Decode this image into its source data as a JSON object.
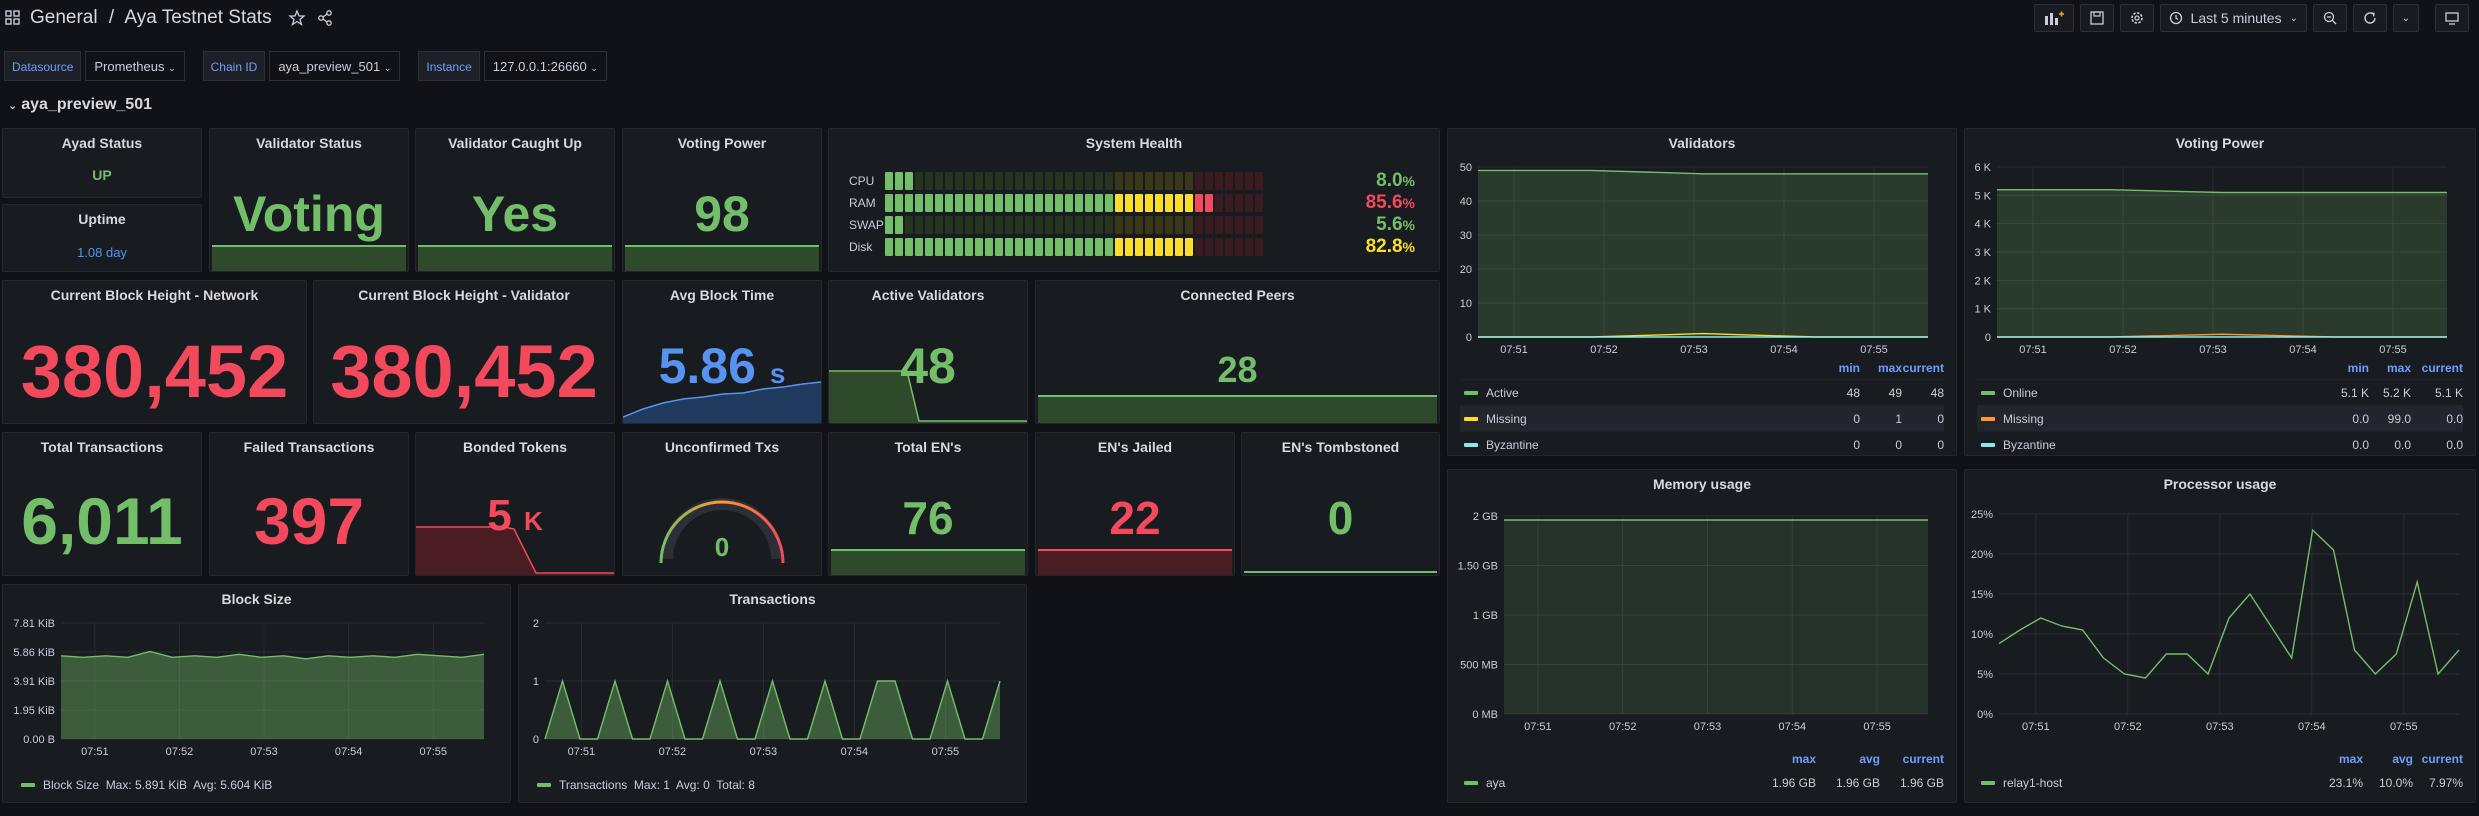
{
  "header": {
    "folder": "General",
    "separator": "/",
    "title": "Aya Testnet Stats",
    "time_range": "Last 5 minutes"
  },
  "variables": [
    {
      "label": "Datasource",
      "value": "Prometheus"
    },
    {
      "label": "Chain ID",
      "value": "aya_preview_501"
    },
    {
      "label": "Instance",
      "value": "127.0.0.1:26660"
    }
  ],
  "row_title": "aya_preview_501",
  "colors": {
    "green": "#73bf69",
    "red": "#f2495c",
    "blue": "#5794f2",
    "yellow": "#fade2a",
    "orange": "#ff9830",
    "cyan": "#8ae8e8"
  },
  "stats": {
    "ayad_status": {
      "title": "Ayad Status",
      "value": "UP"
    },
    "uptime": {
      "title": "Uptime",
      "value": "1.08 day"
    },
    "validator_status": {
      "title": "Validator Status",
      "value": "Voting"
    },
    "caught_up": {
      "title": "Validator Caught Up",
      "value": "Yes"
    },
    "voting_power": {
      "title": "Voting Power",
      "value": "98"
    },
    "block_height_network": {
      "title": "Current Block Height - Network",
      "value": "380,452"
    },
    "block_height_validator": {
      "title": "Current Block Height - Validator",
      "value": "380,452"
    },
    "avg_block_time": {
      "title": "Avg Block Time",
      "value": "5.86",
      "unit": "s"
    },
    "active_validators": {
      "title": "Active Validators",
      "value": "48"
    },
    "connected_peers": {
      "title": "Connected Peers",
      "value": "28"
    },
    "total_transactions": {
      "title": "Total Transactions",
      "value": "6,011"
    },
    "failed_transactions": {
      "title": "Failed Transactions",
      "value": "397"
    },
    "bonded_tokens": {
      "title": "Bonded Tokens",
      "value": "5",
      "unit": "K"
    },
    "unconfirmed_txs": {
      "title": "Unconfirmed Txs",
      "value": "0"
    },
    "total_ens": {
      "title": "Total EN's",
      "value": "76"
    },
    "ens_jailed": {
      "title": "EN's Jailed",
      "value": "22"
    },
    "ens_tombstoned": {
      "title": "EN's Tombstoned",
      "value": "0"
    }
  },
  "system_health": {
    "title": "System Health",
    "rows": [
      {
        "label": "CPU",
        "value": "8.0",
        "unit": "%",
        "level": 0.08
      },
      {
        "label": "RAM",
        "value": "85.6",
        "unit": "%",
        "level": 0.856
      },
      {
        "label": "SWAP",
        "value": "5.6",
        "unit": "%",
        "level": 0.056
      },
      {
        "label": "Disk",
        "value": "82.8",
        "unit": "%",
        "level": 0.828
      }
    ]
  },
  "validators_chart": {
    "title": "Validators",
    "chart_data": {
      "type": "line",
      "x": [
        "07:51",
        "07:52",
        "07:53",
        "07:54",
        "07:55"
      ],
      "ylim": [
        0,
        50
      ],
      "yticks": [
        "0",
        "10",
        "20",
        "30",
        "40",
        "50"
      ],
      "series": [
        {
          "name": "Active",
          "values": [
            49,
            49,
            48,
            48,
            48
          ],
          "min": "48",
          "max": "49",
          "current": "48"
        },
        {
          "name": "Missing",
          "values": [
            0,
            0,
            1,
            0,
            0
          ],
          "min": "0",
          "max": "1",
          "current": "0"
        },
        {
          "name": "Byzantine",
          "values": [
            0,
            0,
            0,
            0,
            0
          ],
          "min": "0",
          "max": "0",
          "current": "0"
        }
      ]
    },
    "legend_headers": [
      "min",
      "max",
      "current"
    ]
  },
  "voting_power_chart": {
    "title": "Voting Power",
    "chart_data": {
      "type": "line",
      "x": [
        "07:51",
        "07:52",
        "07:53",
        "07:54",
        "07:55"
      ],
      "ylim": [
        0,
        6000
      ],
      "yticks": [
        "0",
        "1 K",
        "2 K",
        "3 K",
        "4 K",
        "5 K",
        "6 K"
      ],
      "series": [
        {
          "name": "Online",
          "values": [
            5200,
            5200,
            5100,
            5100,
            5100
          ],
          "min": "5.1 K",
          "max": "5.2 K",
          "current": "5.1 K"
        },
        {
          "name": "Missing",
          "values": [
            0,
            0,
            99,
            0,
            0
          ],
          "min": "0.0",
          "max": "99.0",
          "current": "0.0"
        },
        {
          "name": "Byzantine",
          "values": [
            0,
            0,
            0,
            0,
            0
          ],
          "min": "0.0",
          "max": "0.0",
          "current": "0.0"
        }
      ]
    },
    "legend_headers": [
      "min",
      "max",
      "current"
    ]
  },
  "memory_chart": {
    "title": "Memory usage",
    "chart_data": {
      "type": "area",
      "x": [
        "07:51",
        "07:52",
        "07:53",
        "07:54",
        "07:55"
      ],
      "ylim": [
        0,
        2
      ],
      "yticks": [
        "0 MB",
        "500 MB",
        "1 GB",
        "1.50 GB",
        "2 GB"
      ],
      "series": [
        {
          "name": "aya",
          "values": [
            1.96,
            1.96,
            1.96,
            1.96,
            1.96
          ],
          "max": "1.96 GB",
          "avg": "1.96 GB",
          "current": "1.96 GB"
        }
      ]
    },
    "legend_headers": [
      "max",
      "avg",
      "current"
    ]
  },
  "processor_chart": {
    "title": "Processor usage",
    "chart_data": {
      "type": "line",
      "x": [
        "07:51",
        "07:52",
        "07:53",
        "07:54",
        "07:55"
      ],
      "ylim": [
        0,
        25
      ],
      "yticks": [
        "0%",
        "5%",
        "10%",
        "15%",
        "20%",
        "25%"
      ],
      "series": [
        {
          "name": "relay1-host",
          "values": [
            8.8,
            10.5,
            12,
            11,
            10.5,
            7,
            5,
            4.5,
            7.5,
            7.5,
            5,
            12,
            15,
            11,
            7,
            23,
            20.5,
            8,
            5,
            7.5,
            16.5,
            5,
            8
          ],
          "max": "23.1%",
          "avg": "10.0%",
          "current": "7.97%"
        }
      ]
    },
    "legend_headers": [
      "max",
      "avg",
      "current"
    ]
  },
  "block_size_chart": {
    "title": "Block Size",
    "chart_data": {
      "type": "area",
      "x": [
        "07:51",
        "07:52",
        "07:53",
        "07:54",
        "07:55"
      ],
      "yticks": [
        "0.00 B",
        "1.95 KiB",
        "3.91 KiB",
        "5.86 KiB",
        "7.81 KiB"
      ],
      "ylim": [
        0,
        7.81
      ],
      "series": [
        {
          "name": "Block Size",
          "values": [
            5.6,
            5.5,
            5.6,
            5.5,
            5.89,
            5.5,
            5.6,
            5.5,
            5.7,
            5.5,
            5.6,
            5.4,
            5.6,
            5.5,
            5.6,
            5.5,
            5.7,
            5.6,
            5.5,
            5.7
          ]
        }
      ]
    },
    "legend_text": "Block Size  Max: 5.891 KiB  Avg: 5.604 KiB"
  },
  "transactions_chart": {
    "title": "Transactions",
    "chart_data": {
      "type": "area",
      "x": [
        "07:51",
        "07:52",
        "07:53",
        "07:54",
        "07:55"
      ],
      "ylim": [
        0,
        2
      ],
      "yticks": [
        "0",
        "1",
        "2"
      ],
      "series": [
        {
          "name": "Transactions",
          "values": [
            0,
            1,
            0,
            0,
            1,
            0,
            0,
            1,
            0,
            0,
            1,
            0,
            0,
            1,
            0,
            0,
            1,
            0,
            0,
            1,
            1,
            0,
            0,
            1,
            0,
            0,
            1
          ]
        }
      ]
    },
    "legend_text": "Transactions  Max: 1  Avg: 0  Total: 8"
  }
}
